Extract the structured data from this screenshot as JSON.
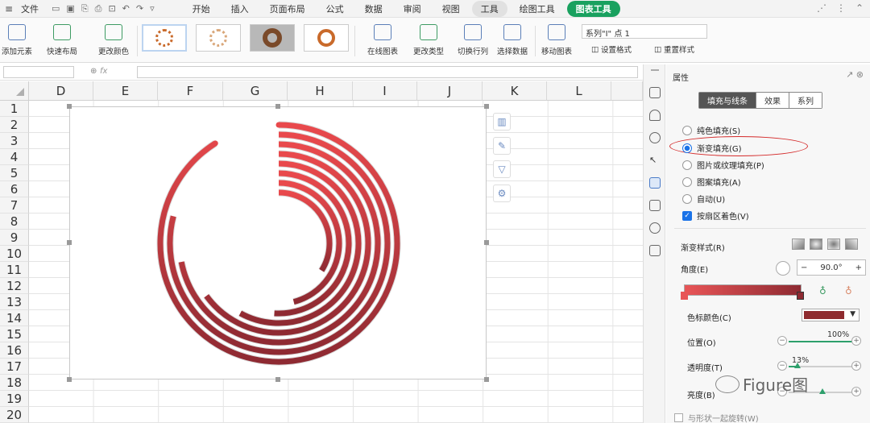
{
  "menubar": {
    "file": "文件",
    "tabs": [
      {
        "label": "开始"
      },
      {
        "label": "插入"
      },
      {
        "label": "页面布局"
      },
      {
        "label": "公式"
      },
      {
        "label": "数据"
      },
      {
        "label": "审阅"
      },
      {
        "label": "视图"
      },
      {
        "label": "工具"
      },
      {
        "label": "绘图工具"
      },
      {
        "label": "图表工具"
      }
    ],
    "active_tab": "图表工具"
  },
  "ribbon": {
    "add_element": "添加元素",
    "quick_layout": "快速布局",
    "change_color": "更改颜色",
    "online_chart": "在线图表",
    "change_type": "更改类型",
    "switch_row_col": "切换行列",
    "select_data": "选择数据",
    "move_chart": "移动图表",
    "series_select": "系列\"I\" 点 1",
    "set_format": "设置格式",
    "reset_style": "重置样式"
  },
  "sheet": {
    "fx": "fx",
    "columns": [
      "D",
      "E",
      "F",
      "G",
      "H",
      "I",
      "J",
      "K",
      "L"
    ],
    "rows": [
      "1",
      "2",
      "3",
      "4",
      "5",
      "6",
      "7",
      "8",
      "9",
      "10",
      "11",
      "12",
      "13",
      "14",
      "15",
      "16",
      "17",
      "18",
      "19",
      "20"
    ]
  },
  "chart_data": {
    "type": "radial_bar",
    "bar_color_start": "#e9494c",
    "bar_color_end": "#8e2a32",
    "rings": [
      {
        "value": 91
      },
      {
        "value": 79
      },
      {
        "value": 72
      },
      {
        "value": 65
      },
      {
        "value": 58
      },
      {
        "value": 51
      },
      {
        "value": 46
      },
      {
        "value": 34
      }
    ],
    "max": 100
  },
  "panel": {
    "title": "属性",
    "tabs": [
      "填充与线条",
      "效果",
      "系列"
    ],
    "active_tab": "填充与线条",
    "fill_options": [
      {
        "label": "纯色填充(S)",
        "checked": false
      },
      {
        "label": "渐变填充(G)",
        "checked": true
      },
      {
        "label": "图片或纹理填充(P)",
        "checked": false
      },
      {
        "label": "图案填充(A)",
        "checked": false
      },
      {
        "label": "自动(U)",
        "checked": false
      }
    ],
    "vary_by_sector": "按扇区着色(V)",
    "gradient_style_label": "渐变样式(R)",
    "angle_label": "角度(E)",
    "angle_value": "90.0°",
    "stop_color_label": "色标颜色(C)",
    "stop_color": "#8f2b2f",
    "position_label": "位置(O)",
    "position_value": "100%",
    "transparency_label": "透明度(T)",
    "transparency_value": "13%",
    "brightness_label": "亮度(B)",
    "rotate_with_shape": "与形状一起旋转(W)",
    "highlight_color": "#d42a2a",
    "accent_color": "#19a15f"
  },
  "watermark": "Figure图"
}
